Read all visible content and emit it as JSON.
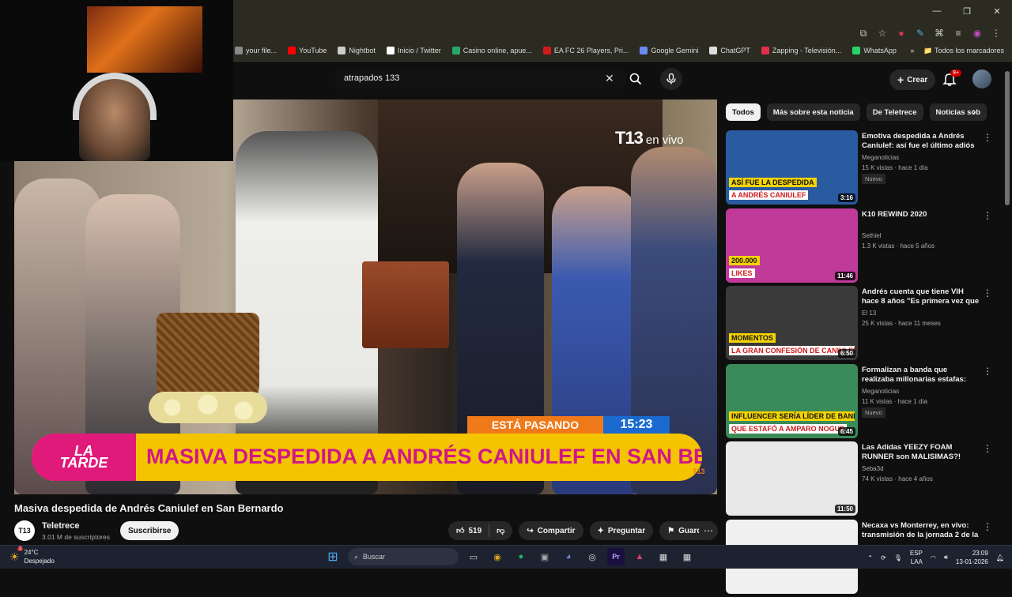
{
  "browser": {
    "bookmarks": [
      {
        "label": "your file...",
        "color": "#888888"
      },
      {
        "label": "YouTube",
        "color": "#ff0000"
      },
      {
        "label": "Nightbot",
        "color": "#cccccc"
      },
      {
        "label": "Inicio / Twitter",
        "color": "#ffffff"
      },
      {
        "label": "Casino online, apue...",
        "color": "#2aa66a"
      },
      {
        "label": "EA FC 26 Players, Pri...",
        "color": "#d01a1a"
      },
      {
        "label": "Google Gemini",
        "color": "#6a8af0"
      },
      {
        "label": "ChatGPT",
        "color": "#dddddd"
      },
      {
        "label": "Zapping - Televisión...",
        "color": "#e0304a"
      },
      {
        "label": "WhatsApp",
        "color": "#25d366"
      }
    ],
    "all_bookmarks": "Todos los marcadores"
  },
  "youtube": {
    "search_value": "atrapados 133",
    "create_label": "Crear",
    "notif_count": "9+"
  },
  "video": {
    "channel_overlay": "T13",
    "channel_overlay_sub": "en vivo",
    "esta_pasando": "ESTÁ PASANDO",
    "clock": "15:23",
    "program_line1": "LA",
    "program_line2": "TARDE",
    "headline": "MASIVA DESPEDIDA A ANDRÉS CANIULEF EN SAN BERNARDO",
    "corner_logo": "T13",
    "title": "Masiva despedida de Andrés Caniulef en San Bernardo",
    "channel_name": "Teletrece",
    "channel_avatar": "T13",
    "subscribers": "3.01 M de suscriptores",
    "subscribe_label": "Suscribirse",
    "likes": "519",
    "share_label": "Compartir",
    "ask_label": "Preguntar",
    "save_label": "Guardar"
  },
  "chips": [
    "Todos",
    "Más sobre esta noticia",
    "De Teletrece",
    "Noticias sob"
  ],
  "recommendations": [
    {
      "title": "Emotiva despedida a Andrés Caniulef: así fue el último adiós a...",
      "channel": "Meganoticias",
      "meta": "15 K vistas · hace 1 día",
      "badge": "Nuevo",
      "duration": "3:16",
      "thumb_text": "ASÍ FUE LA DESPEDIDA",
      "thumb_text2": "A ANDRÉS CANIULEF",
      "thumb_bg": "#2a5aa0"
    },
    {
      "title": "K10 REWIND 2020",
      "channel": "Sethiel",
      "meta": "1.3 K vistas · hace 5 años",
      "badge": "",
      "duration": "11:46",
      "thumb_text": "200.000",
      "thumb_text2": "LIKES",
      "thumb_bg": "#c03a9a"
    },
    {
      "title": "Andrés cuenta que tiene VIH hace 8 años \"Es primera vez que lo ...",
      "channel": "El 13",
      "meta": "25 K vistas · hace 11 meses",
      "badge": "",
      "duration": "6:50",
      "thumb_text": "MOMENTOS",
      "thumb_text2": "LA GRAN CONFESIÓN DE CANIULEF",
      "thumb_bg": "#3a3a3a"
    },
    {
      "title": "Formalizan a banda que realizaba millonarias estafas: apuntan a ...",
      "channel": "Meganoticias",
      "meta": "11 K vistas · hace 1 día",
      "badge": "Nuevo",
      "duration": "6:45",
      "thumb_text": "INFLUENCER SERÍA LÍDER DE BANDA",
      "thumb_text2": "QUE ESTAFÓ A AMPARO NOGUE",
      "thumb_bg": "#3a8a5a"
    },
    {
      "title": "Las Adidas YEEZY FOAM RUNNER son MALISIMAS?!",
      "channel": "Seba3d",
      "meta": "74 K vistas · hace 4 años",
      "badge": "",
      "duration": "11:50",
      "thumb_text": "",
      "thumb_text2": "",
      "thumb_bg": "#e8e8e8"
    },
    {
      "title": "Necaxa vs Monterrey, en vivo: transmisión de la jornada 2 de la ...",
      "channel": "",
      "meta": "",
      "badge": "",
      "duration": "",
      "thumb_text": "",
      "thumb_text2": "",
      "thumb_bg": "#f0f0f0"
    }
  ],
  "taskbar": {
    "temp": "24°C",
    "weather": "Despejado",
    "weather_badge": "2",
    "search_label": "Buscar",
    "lang1": "ESP",
    "lang2": "LAA",
    "time": "23:09",
    "date": "13-01-2026"
  }
}
